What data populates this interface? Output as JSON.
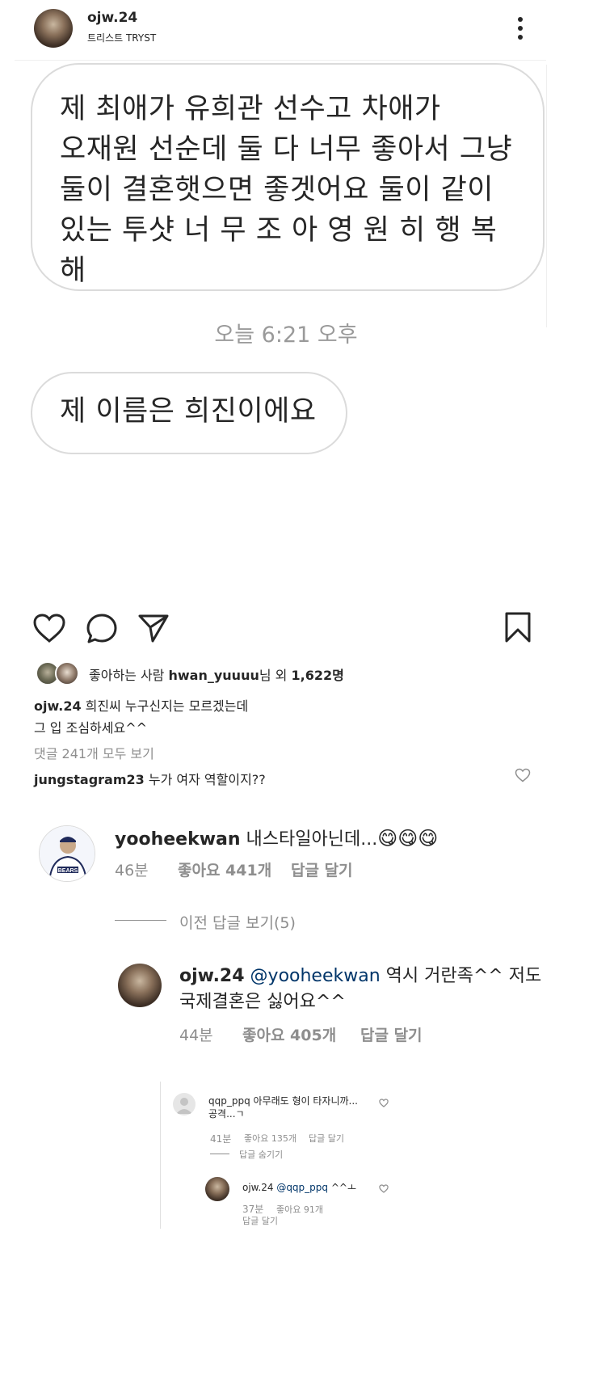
{
  "post": {
    "username": "ojw.24",
    "subtitle": "트리스트 TRYST"
  },
  "messages": {
    "bubble1": [
      "제 최애가 유희관 선수고 차애가",
      "오재원 선순데 둘 다 너무 좋아서 그냥",
      "둘이 결혼햇으면 좋겟어요 둘이 같이",
      "있는 투샷 너 무 조 아 영 원 히 행 복",
      "해"
    ],
    "timestamp": "오늘 6:21 오후",
    "bubble2": "제 이름은 희진이에요"
  },
  "likes": {
    "prefix": "좋아하는 사람 ",
    "user": "hwan_yuuuu",
    "suffix": "님 외 ",
    "count": "1,622명"
  },
  "caption": {
    "username": "ojw.24",
    "line1": " 희진씨 누구신지는 모르겠는데",
    "line2": "그 입 조심하세요^^"
  },
  "view_comments": "댓글 241개 모두 보기",
  "comment1": {
    "username": "jungstagram23",
    "text": " 누가 여자 역할이지??"
  },
  "thread": {
    "username": "yooheekwan",
    "text": " 내스타일아닌데...",
    "emoji": [
      "😋",
      "😋",
      "😋"
    ],
    "time": "46분",
    "likes": "좋아요 441개",
    "reply": "답글 달기"
  },
  "prev_replies": "이전 답글 보기(5)",
  "reply1": {
    "username": "ojw.24",
    "mention": "@yooheekwan",
    "text1": " 역시 거란족^^ 저도",
    "text2": "국제결혼은 싫어요^^",
    "time": "44분",
    "likes": "좋아요 405개",
    "reply": "답글 달기"
  },
  "inner": {
    "comment": {
      "username": "qqp_ppq",
      "text1": " 아무래도 형이 타자니까...",
      "text2": "공격...ㄱ",
      "time": "41분",
      "likes": "좋아요 135개",
      "reply": "답글 달기",
      "hide": "답글 숨기기"
    },
    "reply": {
      "username": "ojw.24",
      "mention": "@qqp_ppq",
      "text": " ^^ㅗ",
      "time": "37분",
      "likes": "좋아요 91개",
      "reply": "답글 달기"
    }
  },
  "colors": {
    "text": "#262626",
    "gray": "#8e8e8e",
    "border": "#dbdbdb",
    "link": "#003569"
  }
}
